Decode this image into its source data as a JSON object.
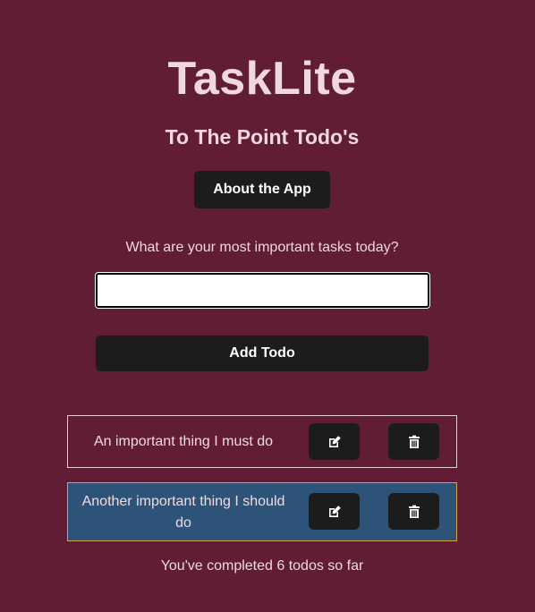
{
  "header": {
    "title": "TaskLite",
    "subtitle": "To The Point Todo's",
    "about_label": "About the App"
  },
  "form": {
    "prompt": "What are your most important tasks today?",
    "input_value": "",
    "add_label": "Add Todo"
  },
  "todos": [
    {
      "text": "An important thing I must do",
      "edit_icon": "edit-icon",
      "delete_icon": "trash-icon"
    },
    {
      "text": "Another important thing I should do",
      "edit_icon": "edit-icon",
      "delete_icon": "trash-icon"
    }
  ],
  "footer": {
    "completed_text": "You've completed 6 todos so far"
  },
  "colors": {
    "background": "#611c36",
    "button": "#1c1c1c",
    "selected_item_bg": "#2e5378",
    "selected_item_border": "#d9a14c"
  }
}
